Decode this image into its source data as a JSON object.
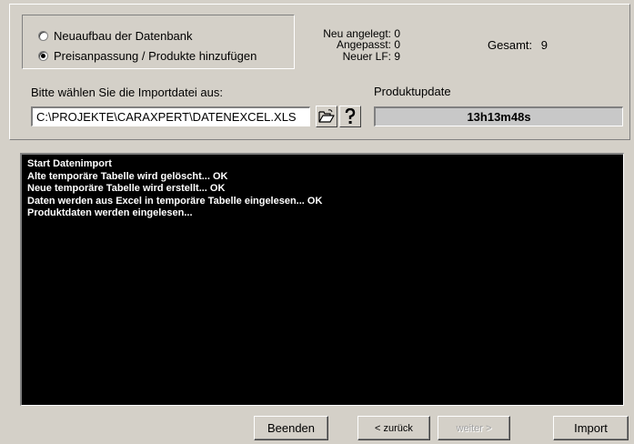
{
  "mode": {
    "options": [
      {
        "label": "Neuaufbau der Datenbank",
        "selected": false
      },
      {
        "label": "Preisanpassung / Produkte hinzufügen",
        "selected": true
      }
    ]
  },
  "stats": {
    "new_label": "Neu angelegt:",
    "new_value": "0",
    "adjusted_label": "Angepasst:",
    "adjusted_value": "0",
    "newlf_label": "Neuer LF:",
    "newlf_value": "9",
    "total_label": "Gesamt:",
    "total_value": "9"
  },
  "import_file": {
    "label": "Bitte wählen Sie die Importdatei aus:",
    "value": "C:\\PROJEKTE\\CARAXPERT\\DATENEXCEL.XLS"
  },
  "product_update": {
    "label": "Produktupdate",
    "elapsed": "13h13m48s"
  },
  "log": {
    "lines": [
      "Start Datenimport",
      "Alte temporäre Tabelle wird gelöscht... OK",
      "Neue temporäre Tabelle wird erstellt... OK",
      "Daten werden aus Excel in temporäre Tabelle eingelesen... OK",
      "Produktdaten werden eingelesen..."
    ]
  },
  "buttons": {
    "exit": "Beenden",
    "back": "< zurück",
    "next": "weiter >",
    "import": "Import"
  },
  "icons": {
    "open_folder": "folder-open-icon",
    "help": "question-mark-icon"
  }
}
